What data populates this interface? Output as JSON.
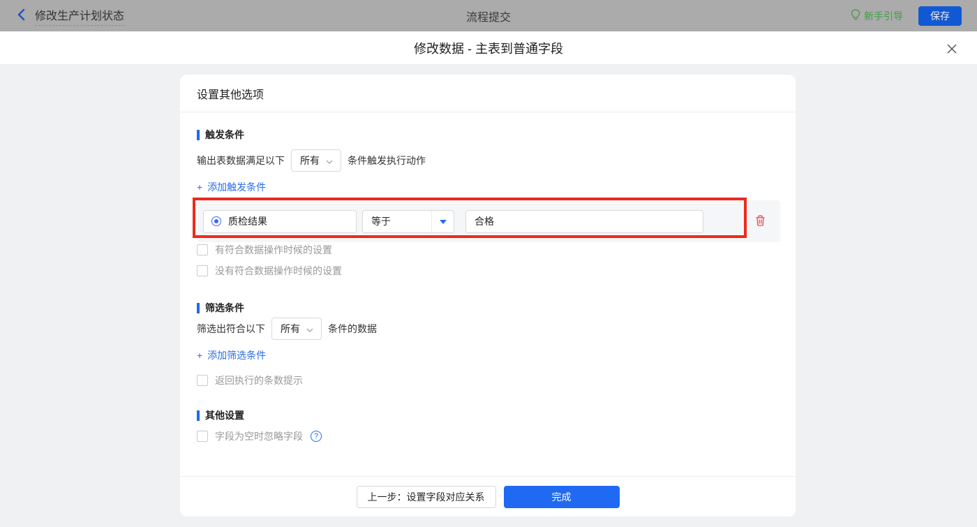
{
  "topbar": {
    "title": "修改生产计划状态",
    "center_title": "流程提交",
    "guide_label": "新手引导",
    "save_label": "保存"
  },
  "dialog": {
    "title": "修改数据 - 主表到普通字段"
  },
  "card": {
    "header": "设置其他选项",
    "trigger_section": {
      "title": "触发条件",
      "sentence_prefix": "输出表数据满足以下",
      "select_value": "所有",
      "sentence_suffix": "条件触发执行动作",
      "add_label": "添加触发条件",
      "condition_row": {
        "field_value": "质检结果",
        "operator_value": "等于",
        "value": "合格"
      },
      "checkbox_has_match": "有符合数据操作时候的设置",
      "checkbox_no_match": "没有符合数据操作时候的设置"
    },
    "filter_section": {
      "title": "筛选条件",
      "sentence_prefix": "筛选出符合以下",
      "select_value": "所有",
      "sentence_suffix": "条件的数据",
      "add_label": "添加筛选条件",
      "checkbox_count_hint": "返回执行的条数提示"
    },
    "other_section": {
      "title": "其他设置",
      "checkbox_ignore_empty": "字段为空时忽略字段"
    },
    "footer": {
      "prev_label": "上一步：设置字段对应关系",
      "done_label": "完成"
    }
  },
  "icons": {
    "plus": "+",
    "help": "?"
  },
  "colors": {
    "primary_blue": "#2069f2",
    "link_blue": "#2b6de8",
    "save_blue": "#1159d4",
    "guide_green": "#3f9e42",
    "danger_red": "#f5434e",
    "highlight_red": "#ec2b1e",
    "topbar_gray": "#ababab",
    "row_gray": "#f5f6f7"
  }
}
